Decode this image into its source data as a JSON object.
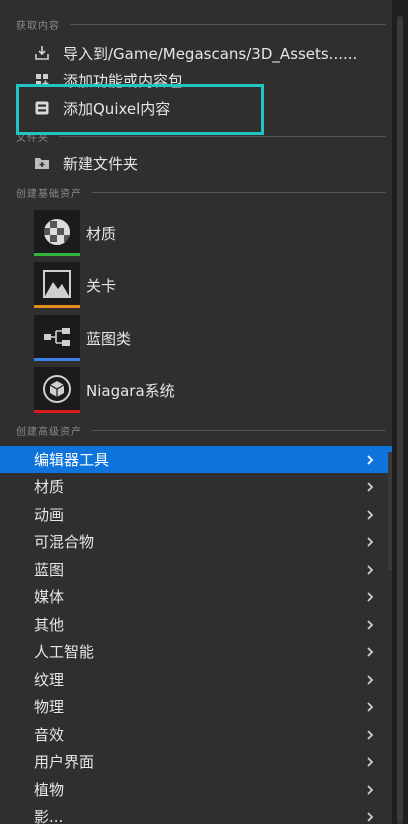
{
  "sections": {
    "get_content": "获取内容",
    "folder": "文件夹",
    "create_basic": "创建基础资产",
    "create_advanced": "创建高级资产"
  },
  "get_content_items": [
    {
      "label": "导入到/Game/Megascans/3D_Assets......",
      "icon": "import-icon"
    },
    {
      "label": "添加功能或内容包......",
      "icon": "feature-pack-icon"
    },
    {
      "label": "添加Quixel内容",
      "icon": "quixel-bridge-icon"
    }
  ],
  "folder_items": [
    {
      "label": "新建文件夹",
      "icon": "new-folder-icon"
    }
  ],
  "basic_assets": [
    {
      "label": "材质",
      "icon": "material-sphere-icon",
      "color": "#2fb33a"
    },
    {
      "label": "关卡",
      "icon": "level-mountain-icon",
      "color": "#e58a1d"
    },
    {
      "label": "蓝图类",
      "icon": "blueprint-graph-icon",
      "color": "#3b7fe6"
    },
    {
      "label": "Niagara系统",
      "icon": "niagara-cube-icon",
      "color": "#d91b1b"
    }
  ],
  "advanced_assets": [
    {
      "label": "编辑器工具",
      "active": true
    },
    {
      "label": "材质"
    },
    {
      "label": "动画"
    },
    {
      "label": "可混合物"
    },
    {
      "label": "蓝图"
    },
    {
      "label": "媒体"
    },
    {
      "label": "其他"
    },
    {
      "label": "人工智能"
    },
    {
      "label": "纹理"
    },
    {
      "label": "物理"
    },
    {
      "label": "音效"
    },
    {
      "label": "用户界面"
    },
    {
      "label": "植物"
    },
    {
      "label": "影..."
    }
  ],
  "colors": {
    "highlight_box": "#23c4c4",
    "active_row": "#0e74da"
  }
}
